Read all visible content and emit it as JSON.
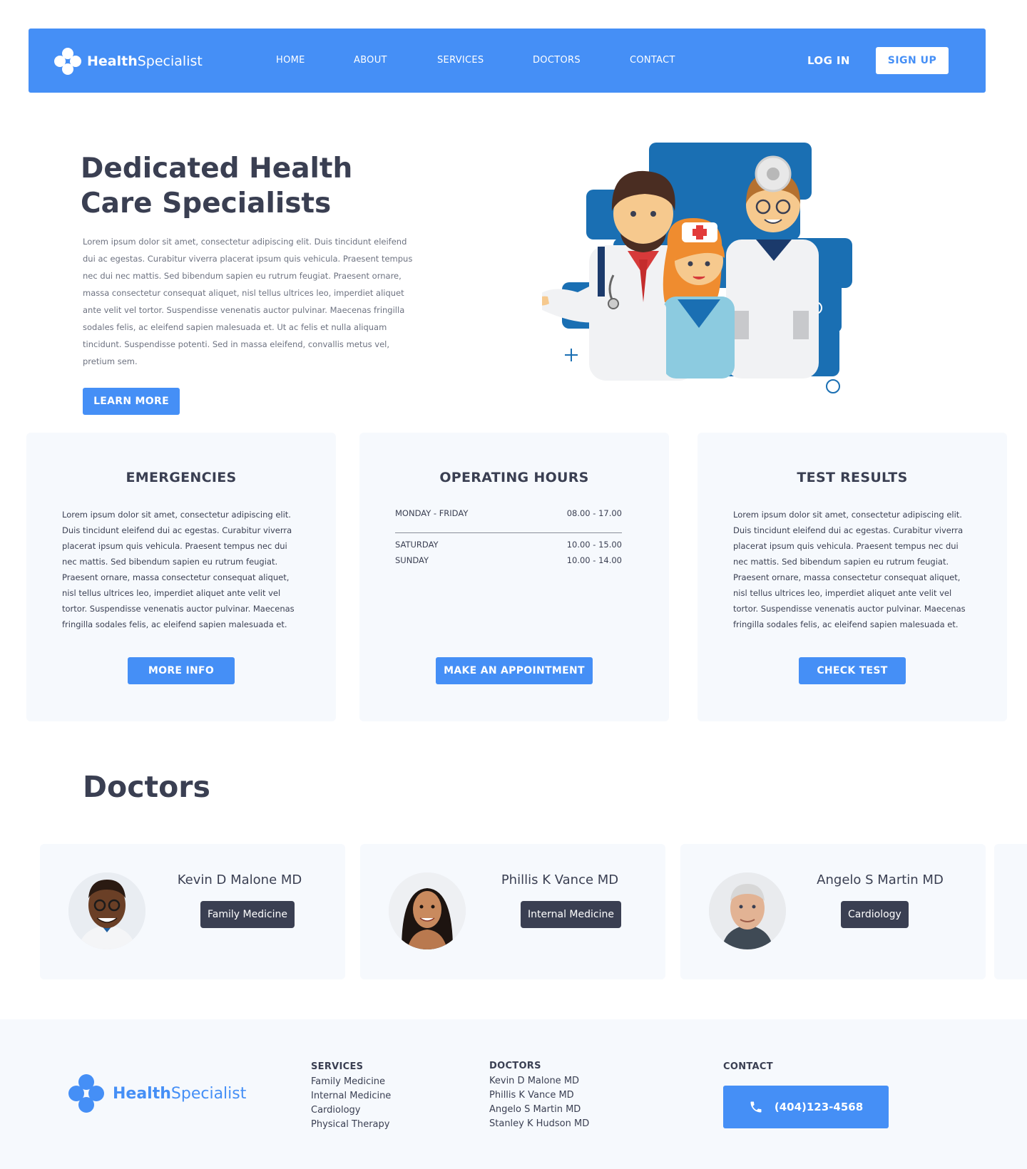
{
  "brand": {
    "name_bold": "Health",
    "name_light": "Specialist"
  },
  "nav": {
    "links": [
      "HOME",
      "ABOUT",
      "SERVICES",
      "DOCTORS",
      "CONTACT"
    ],
    "login": "LOG IN",
    "signup": "SIGN UP"
  },
  "hero": {
    "title": "Dedicated Health Care Specialists",
    "text": "Lorem ipsum dolor sit amet, consectetur adipiscing elit. Duis tincidunt eleifend dui ac egestas. Curabitur viverra placerat ipsum quis vehicula. Praesent tempus nec dui nec mattis. Sed bibendum sapien eu rutrum feugiat. Praesent ornare, massa consectetur consequat aliquet, nisl tellus ultrices leo, imperdiet aliquet ante velit vel tortor. Suspendisse venenatis auctor pulvinar. Maecenas fringilla sodales felis, ac eleifend sapien malesuada et. Ut ac felis et nulla aliquam tincidunt. Suspendisse potenti. Sed in massa eleifend, convallis metus vel, pretium sem.",
    "button": "LEARN MORE"
  },
  "cards": {
    "emergencies": {
      "title": "EMERGENCIES",
      "text": "Lorem ipsum dolor sit amet, consectetur adipiscing elit. Duis tincidunt eleifend dui ac egestas. Curabitur viverra placerat ipsum quis vehicula. Praesent tempus nec dui nec mattis. Sed bibendum sapien eu rutrum feugiat. Praesent ornare, massa consectetur consequat aliquet, nisl tellus ultrices leo, imperdiet aliquet ante velit vel tortor. Suspendisse venenatis auctor pulvinar. Maecenas fringilla sodales felis, ac eleifend sapien malesuada et.",
      "button": "MORE INFO"
    },
    "hours": {
      "title": "OPERATING HOURS",
      "rows": [
        {
          "day": "MONDAY - FRIDAY",
          "time": "08.00 - 17.00"
        },
        {
          "day": "SATURDAY",
          "time": "10.00 - 15.00"
        },
        {
          "day": "SUNDAY",
          "time": "10.00 - 14.00"
        }
      ],
      "button": "MAKE AN APPOINTMENT"
    },
    "test_results": {
      "title": "TEST RESULTS",
      "text": "Lorem ipsum dolor sit amet, consectetur adipiscing elit. Duis tincidunt eleifend dui ac egestas. Curabitur viverra placerat ipsum quis vehicula. Praesent tempus nec dui nec mattis. Sed bibendum sapien eu rutrum feugiat. Praesent ornare, massa consectetur consequat aliquet, nisl tellus ultrices leo, imperdiet aliquet ante velit vel tortor. Suspendisse venenatis auctor pulvinar. Maecenas fringilla sodales felis, ac eleifend sapien malesuada et.",
      "button": "CHECK TEST"
    }
  },
  "doctors": {
    "title": "Doctors",
    "list": [
      {
        "name": "Kevin D Malone MD",
        "specialty": "Family Medicine"
      },
      {
        "name": "Phillis K Vance MD",
        "specialty": "Internal Medicine"
      },
      {
        "name": "Angelo S Martin MD",
        "specialty": "Cardiology"
      }
    ]
  },
  "footer": {
    "services": {
      "heading": "SERVICES",
      "items": [
        "Family Medicine",
        "Internal Medicine",
        "Cardiology",
        "Physical Therapy"
      ]
    },
    "doctors": {
      "heading": "DOCTORS",
      "items": [
        "Kevin D Malone MD",
        "Phillis K Vance MD",
        "Angelo S Martin MD",
        "Stanley K Hudson MD"
      ]
    },
    "contact": {
      "heading": "CONTACT",
      "phone": "(404)123-4568"
    }
  },
  "colors": {
    "accent": "#458ff6",
    "dark": "#3a3f52",
    "card_bg": "#f6f9fd",
    "illustration_blue": "#1a6fb3"
  },
  "icons": [
    "logo-mark-icon",
    "phone-icon"
  ]
}
